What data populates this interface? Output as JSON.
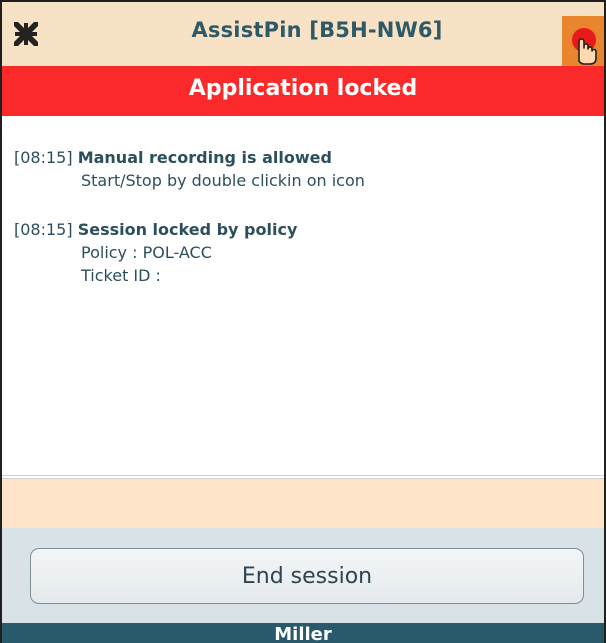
{
  "window": {
    "title": "AssistPin [B5H-NW6]",
    "icons": {
      "collapse": "collapse-arrows-icon",
      "record": "record-hand-icon"
    }
  },
  "banner": {
    "text": "Application locked",
    "color": "#fa2a2a"
  },
  "log": {
    "entries": [
      {
        "time": "[08:15]",
        "heading": "Manual recording is allowed",
        "details": [
          "Start/Stop by double clickin on icon"
        ]
      },
      {
        "time": "[08:15]",
        "heading": "Session locked by policy",
        "details": [
          "Policy : POL-ACC",
          "Ticket ID :"
        ]
      }
    ]
  },
  "input": {
    "value": ""
  },
  "actions": {
    "end_session_label": "End session"
  },
  "user": {
    "name": "Miller"
  },
  "colors": {
    "titlebar": "#f8e2c5",
    "accent_text": "#2e5a68",
    "user_bar": "#285a6b",
    "record_button": "#e9852c"
  }
}
